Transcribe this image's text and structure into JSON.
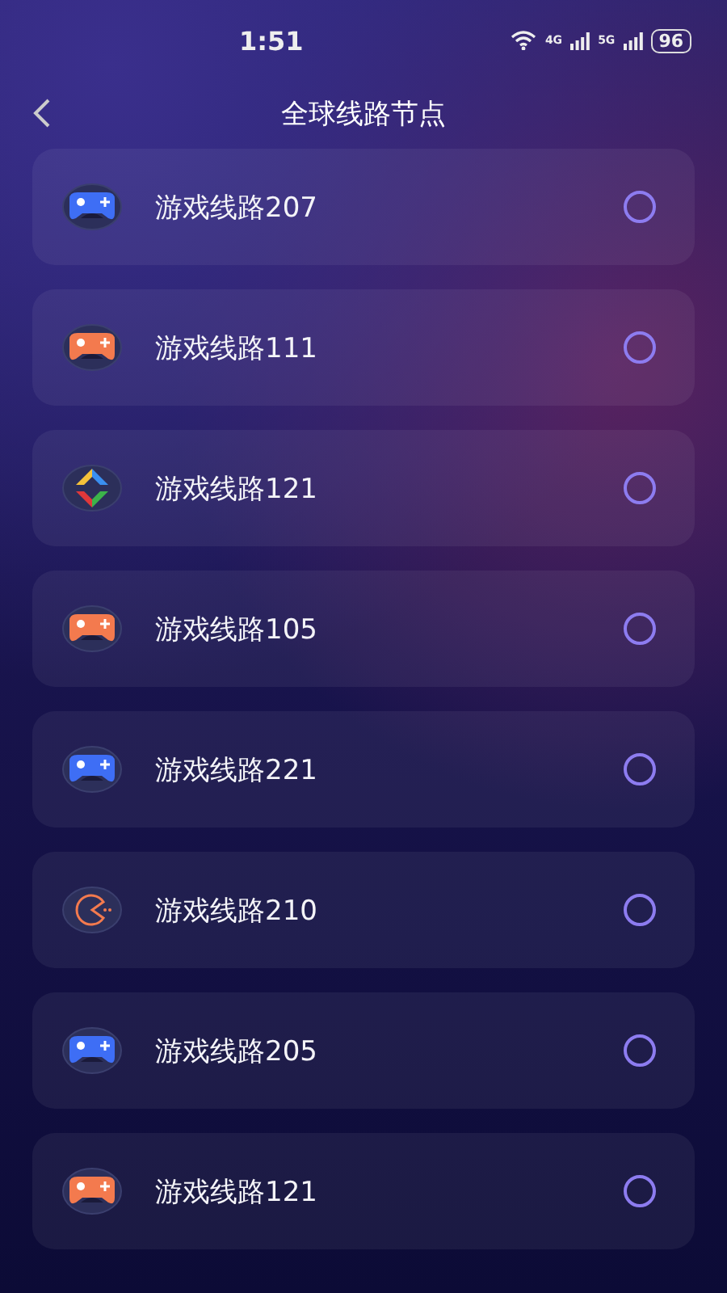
{
  "status_bar": {
    "time": "1:51",
    "network_1": "4G",
    "network_2": "5G",
    "battery": "96"
  },
  "header": {
    "title": "全球线路节点"
  },
  "nodes": [
    {
      "name": "游戏线路207",
      "kind": "gamepad",
      "color": "#3e6ef5",
      "selected": false
    },
    {
      "name": "游戏线路111",
      "kind": "gamepad",
      "color": "#f37a4e",
      "selected": false
    },
    {
      "name": "游戏线路121",
      "kind": "diamond",
      "selected": false
    },
    {
      "name": "游戏线路105",
      "kind": "gamepad",
      "color": "#f37a4e",
      "selected": false
    },
    {
      "name": "游戏线路221",
      "kind": "gamepad",
      "color": "#3e6ef5",
      "selected": false
    },
    {
      "name": "游戏线路210",
      "kind": "pacman",
      "selected": false
    },
    {
      "name": "游戏线路205",
      "kind": "gamepad",
      "color": "#3e6ef5",
      "selected": false
    },
    {
      "name": "游戏线路121",
      "kind": "gamepad",
      "color": "#f37a4e",
      "selected": false
    }
  ]
}
